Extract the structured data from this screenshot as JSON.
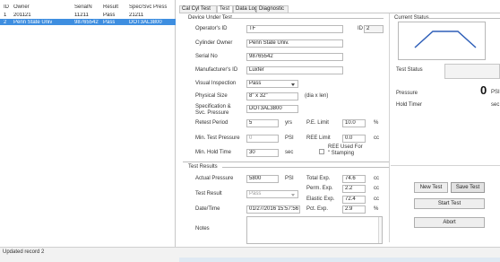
{
  "grid": {
    "columns": [
      "ID",
      "Owner",
      "SerialN",
      "Result",
      "Spec/Svc Press"
    ],
    "rows": [
      [
        "1",
        "201121",
        "11211",
        "Pass",
        "21211"
      ],
      [
        "2",
        "Penn State Univ",
        "98765542",
        "Pass",
        "DOT3AL3800"
      ]
    ]
  },
  "tabs": [
    "Cal Cyl Test",
    "Test",
    "Data Log",
    "Diagnostic"
  ],
  "device": {
    "group_title": "Device Under Test",
    "operator_label": "Operator's ID",
    "operator_value": "TF",
    "id_label": "ID",
    "id_value": "2",
    "owner_label": "Cylinder Owner",
    "owner_value": "Penn State Univ.",
    "serial_label": "Serial No",
    "serial_value": "98765542",
    "manufacturer_label": "Manufacturer's ID",
    "manufacturer_value": "Luxfer",
    "visual_label": "Visual Inspection",
    "visual_value": "Pass",
    "physical_label": "Physical Size",
    "physical_value": "8\" x 32\"",
    "physical_hint": "(dia x len)",
    "spec_label_1": "Specification &",
    "spec_label_2": "Svc. Pressure",
    "spec_value": "DOT3AL3800",
    "retest_label": "Retest Period",
    "retest_value": "5",
    "retest_unit": "yrs",
    "pe_limit_label": "P.E. Limit",
    "pe_limit_value": "10.0",
    "pe_limit_unit": "%",
    "min_pressure_label": "Min. Test Pressure",
    "min_pressure_value": "0",
    "min_pressure_unit": "PSI",
    "ree_limit_label": "REE Limit",
    "ree_limit_value": "0.0",
    "ree_limit_unit": "cc",
    "min_hold_label": "Min. Hold Time",
    "min_hold_value": "30",
    "min_hold_unit": "sec",
    "ree_used_label_1": "REE Used For",
    "ree_used_label_2": "\" Stamping"
  },
  "results": {
    "group_title": "Test Results",
    "actual_pressure_label": "Actual Pressure",
    "actual_pressure_value": "5800",
    "actual_pressure_unit": "PSI",
    "total_exp_label": "Total Exp.",
    "total_exp_value": "74.6",
    "total_exp_unit": "cc",
    "perm_exp_label": "Perm. Exp.",
    "perm_exp_value": "2.2",
    "perm_exp_unit": "cc",
    "test_result_label": "Test Result",
    "test_result_value": "Pass",
    "elastic_exp_label": "Elastic Exp.",
    "elastic_exp_value": "72.4",
    "elastic_exp_unit": "cc",
    "datetime_label": "Date/Time",
    "datetime_value": "01/27/2016 15:57:56",
    "pct_exp_label": "Pct. Exp.",
    "pct_exp_value": "2.9",
    "pct_exp_unit": "%",
    "notes_label": "Notes",
    "notes_value": ""
  },
  "status_panel": {
    "group_title": "Current Status",
    "test_status_label": "Test Status",
    "test_status_value": "",
    "pressure_label": "Pressure",
    "pressure_value": "0",
    "pressure_unit": "PSI",
    "hold_timer_label": "Hold Timer",
    "hold_timer_unit": "sec",
    "graph_color": "#2f5fb8"
  },
  "buttons": {
    "new_test": "New Test",
    "save_test": "Save Test",
    "start_test": "Start Test",
    "abort": "Abort"
  },
  "statusbar": {
    "text": "Updated record 2"
  }
}
